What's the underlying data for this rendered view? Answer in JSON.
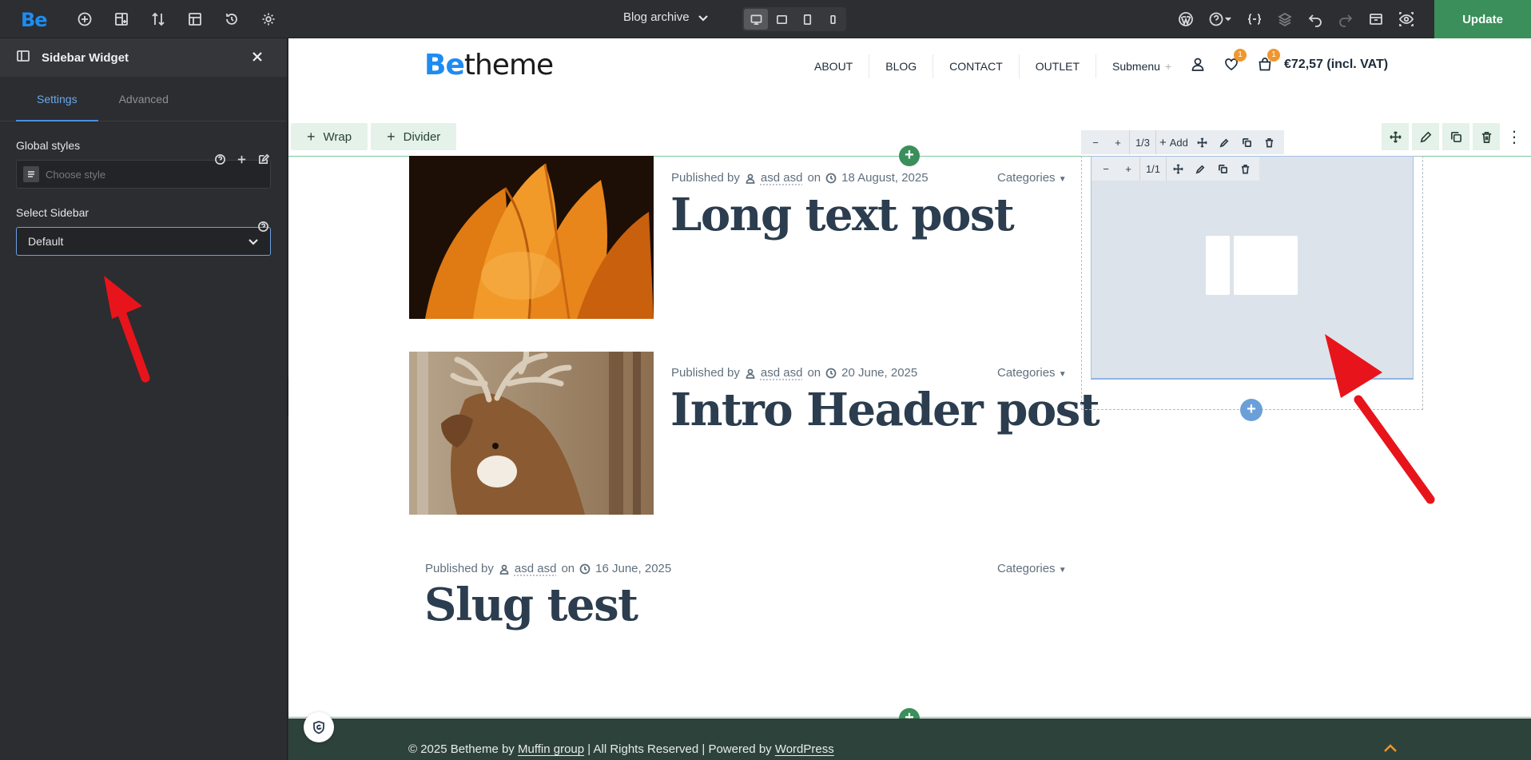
{
  "app": {
    "logo": "Be",
    "page_name": "Blog archive",
    "update_label": "Update"
  },
  "panel": {
    "title": "Sidebar Widget",
    "tabs": [
      {
        "label": "Settings",
        "active": true
      },
      {
        "label": "Advanced",
        "active": false
      }
    ],
    "global_styles_label": "Global styles",
    "choose_style_placeholder": "Choose style",
    "select_sidebar_label": "Select Sidebar",
    "select_sidebar_value": "Default"
  },
  "site": {
    "logo_be": "Be",
    "logo_theme": "theme",
    "nav": [
      "ABOUT",
      "BLOG",
      "CONTACT",
      "OUTLET",
      "Submenu"
    ],
    "submenu_plus": "+",
    "wishlist_count": "1",
    "cart_count": "1",
    "cart_total": "€72,57 (incl. VAT)"
  },
  "builder": {
    "wrap_btn": "Wrap",
    "divider_btn": "Divider",
    "wrap_outer_ratio": "1/3",
    "wrap_outer_add": "Add",
    "wrap_inner_ratio": "1/1"
  },
  "posts": [
    {
      "published_by": "Published by",
      "author": "asd asd",
      "on": "on",
      "date": "18 August, 2025",
      "categories": "Categories",
      "title": "Long text post"
    },
    {
      "published_by": "Published by",
      "author": "asd asd",
      "on": "on",
      "date": "20 June, 2025",
      "categories": "Categories",
      "title": "Intro Header post"
    },
    {
      "published_by": "Published by",
      "author": "asd asd",
      "on": "on",
      "date": "16 June, 2025",
      "categories": "Categories",
      "title": "Slug test"
    }
  ],
  "footer": {
    "prefix": "© 2025 Betheme by ",
    "muffin": "Muffin group",
    "middle": " | All Rights Reserved | Powered by ",
    "wordpress": "WordPress"
  },
  "colors": {
    "accent_blue": "#1e8cf0",
    "update_green": "#3a8f5a",
    "badge_orange": "#f0962d",
    "arrow_red": "#e8141b"
  }
}
